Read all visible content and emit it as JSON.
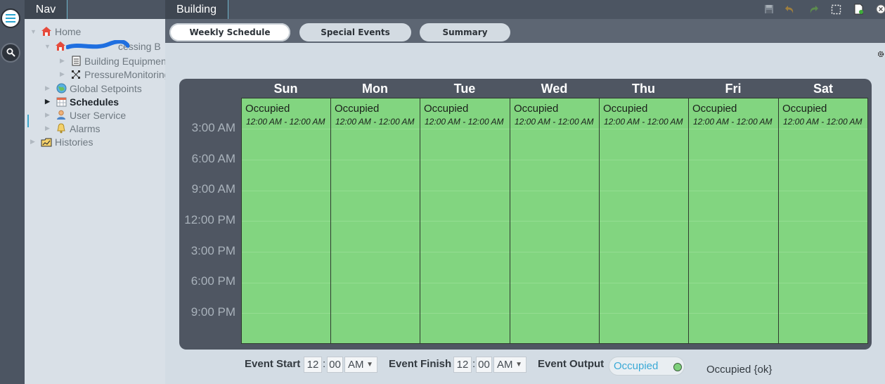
{
  "nav": {
    "tab_label": "Nav",
    "tree": [
      {
        "label": "Home",
        "icon": "house-icon"
      },
      {
        "label": "cessing B",
        "icon": "house-icon"
      },
      {
        "label": "Building Equipmen",
        "icon": "document-icon"
      },
      {
        "label": "PressureMonitoring",
        "icon": "network-icon"
      },
      {
        "label": "Global Setpoints",
        "icon": "globe-icon"
      },
      {
        "label": "Schedules",
        "icon": "calendar-icon"
      },
      {
        "label": "User Service",
        "icon": "user-icon"
      },
      {
        "label": "Alarms",
        "icon": "bell-icon"
      },
      {
        "label": "Histories",
        "icon": "history-icon"
      }
    ]
  },
  "main": {
    "tab_label": "Building",
    "toolbar": [
      "save-icon",
      "undo-icon",
      "redo-icon",
      "select-icon",
      "export-icon",
      "close-icon"
    ]
  },
  "tabs": [
    "Weekly Schedule",
    "Special Events",
    "Summary"
  ],
  "schedule": {
    "days": [
      "Sun",
      "Mon",
      "Tue",
      "Wed",
      "Thu",
      "Fri",
      "Sat"
    ],
    "times": [
      "3:00 AM",
      "6:00 AM",
      "9:00 AM",
      "12:00 PM",
      "3:00 PM",
      "6:00 PM",
      "9:00 PM"
    ],
    "event_title": "Occupied",
    "event_range": "12:00 AM - 12:00 AM",
    "colors": {
      "event": "#82d580",
      "panel": "#4f5662"
    }
  },
  "event": {
    "start_label": "Event Start",
    "start_hour": "12",
    "start_min": "00",
    "start_ampm": "AM",
    "finish_label": "Event Finish",
    "finish_hour": "12",
    "finish_min": "00",
    "finish_ampm": "AM",
    "output_label": "Event Output",
    "output_value": "Occupied",
    "status": "Occupied {ok}"
  }
}
